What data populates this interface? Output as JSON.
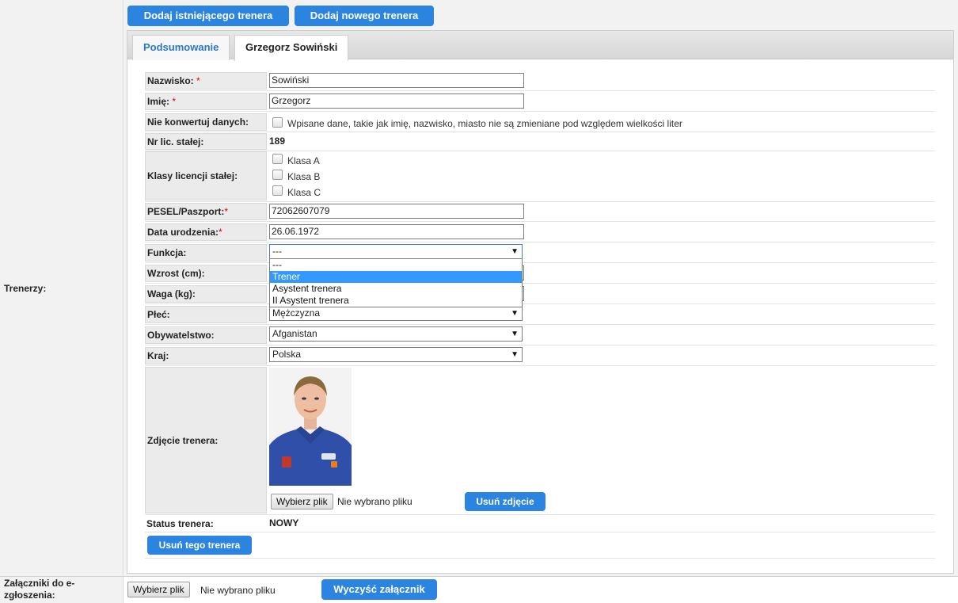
{
  "left": {
    "trainers_label": "Trenerzy:",
    "attachments_label": "Załączniki do e-zgłoszenia:"
  },
  "toolbar": {
    "add_existing": "Dodaj istniejącego trenera",
    "add_new": "Dodaj nowego trenera"
  },
  "tabs": [
    {
      "label": "Podsumowanie"
    },
    {
      "label": "Grzegorz Sowiński"
    }
  ],
  "form": {
    "surname_label": "Nazwisko:",
    "surname_value": "Sowiński",
    "firstname_label": "Imię:",
    "firstname_value": "Grzegorz",
    "noconvert_label": "Nie konwertuj danych:",
    "noconvert_text": "Wpisane dane, takie jak imię, nazwisko, miasto nie są zmieniane pod względem wielkości liter",
    "license_label": "Nr lic. stałej:",
    "license_value": "189",
    "classes_label": "Klasy licencji stałej:",
    "classes": [
      "Klasa A",
      "Klasa B",
      "Klasa C"
    ],
    "pesel_label": "PESEL/Paszport:",
    "pesel_value": "72062607079",
    "birth_label": "Data urodzenia:",
    "birth_value": "26.06.1972",
    "function_label": "Funkcja:",
    "function_value": "---",
    "function_options": [
      "---",
      "Trener",
      "Asystent trenera",
      "II Asystent trenera"
    ],
    "height_label": "Wzrost (cm):",
    "weight_label": "Waga (kg):",
    "sex_label": "Płeć:",
    "sex_value": "Mężczyzna",
    "citizenship_label": "Obywatelstwo:",
    "citizenship_value": "Afganistan",
    "country_label": "Kraj:",
    "country_value": "Polska",
    "photo_label": "Zdjęcie trenera:",
    "choose_file": "Wybierz plik",
    "no_file": "Nie wybrano pliku",
    "remove_photo": "Usuń zdjęcie",
    "status_label": "Status trenera:",
    "status_value": "NOWY",
    "remove_trainer": "Usuń tego trenera"
  },
  "attachments": {
    "choose_file": "Wybierz plik",
    "no_file": "Nie wybrano pliku",
    "clear": "Wyczyść załącznik"
  },
  "colors": {
    "accent": "#2a84e0",
    "dropdown_highlight": "#3399ff",
    "required": "#dd0000"
  }
}
